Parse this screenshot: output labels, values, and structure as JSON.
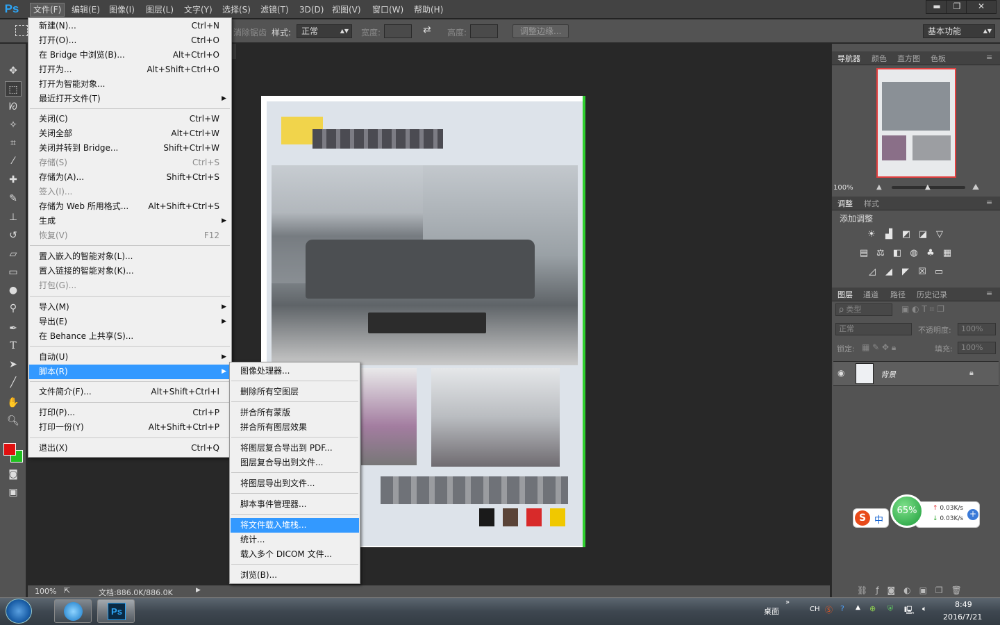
{
  "app": {
    "logo": "Ps"
  },
  "menubar": {
    "items": [
      "文件(F)",
      "编辑(E)",
      "图像(I)",
      "图层(L)",
      "文字(Y)",
      "选择(S)",
      "滤镜(T)",
      "3D(D)",
      "视图(V)",
      "窗口(W)",
      "帮助(H)"
    ],
    "window_buttons": {
      "minimize": "▬",
      "restore": "❐",
      "close": "✕"
    }
  },
  "options_bar": {
    "antialias_label": "消除锯齿",
    "style_label": "样式:",
    "style_value": "正常",
    "width_label": "宽度:",
    "height_label": "高度:",
    "refine_edge": "调整边缘...",
    "workspace": "基本功能"
  },
  "file_menu": {
    "items": [
      {
        "label": "新建(N)...",
        "shortcut": "Ctrl+N"
      },
      {
        "label": "打开(O)...",
        "shortcut": "Ctrl+O"
      },
      {
        "label": "在 Bridge 中浏览(B)...",
        "shortcut": "Alt+Ctrl+O"
      },
      {
        "label": "打开为...",
        "shortcut": "Alt+Shift+Ctrl+O"
      },
      {
        "label": "打开为智能对象...",
        "shortcut": ""
      },
      {
        "label": "最近打开文件(T)",
        "shortcut": ""
      },
      {
        "label": "关闭(C)",
        "shortcut": "Ctrl+W"
      },
      {
        "label": "关闭全部",
        "shortcut": "Alt+Ctrl+W"
      },
      {
        "label": "关闭并转到 Bridge...",
        "shortcut": "Shift+Ctrl+W"
      },
      {
        "label": "存储(S)",
        "shortcut": "Ctrl+S"
      },
      {
        "label": "存储为(A)...",
        "shortcut": "Shift+Ctrl+S"
      },
      {
        "label": "签入(I)...",
        "shortcut": ""
      },
      {
        "label": "存储为 Web 所用格式...",
        "shortcut": "Alt+Shift+Ctrl+S"
      },
      {
        "label": "生成",
        "shortcut": ""
      },
      {
        "label": "恢复(V)",
        "shortcut": "F12"
      },
      {
        "label": "置入嵌入的智能对象(L)...",
        "shortcut": ""
      },
      {
        "label": "置入链接的智能对象(K)...",
        "shortcut": ""
      },
      {
        "label": "打包(G)...",
        "shortcut": ""
      },
      {
        "label": "导入(M)",
        "shortcut": ""
      },
      {
        "label": "导出(E)",
        "shortcut": ""
      },
      {
        "label": "在 Behance 上共享(S)...",
        "shortcut": ""
      },
      {
        "label": "自动(U)",
        "shortcut": ""
      },
      {
        "label": "脚本(R)",
        "shortcut": ""
      },
      {
        "label": "文件简介(F)...",
        "shortcut": "Alt+Shift+Ctrl+I"
      },
      {
        "label": "打印(P)...",
        "shortcut": "Ctrl+P"
      },
      {
        "label": "打印一份(Y)",
        "shortcut": "Alt+Shift+Ctrl+P"
      },
      {
        "label": "退出(X)",
        "shortcut": "Ctrl+Q"
      }
    ]
  },
  "scripts_menu": {
    "items": [
      "图像处理器...",
      "删除所有空图层",
      "拼合所有蒙版",
      "拼合所有图层效果",
      "将图层复合导出到 PDF...",
      "图层复合导出到文件...",
      "将图层导出到文件...",
      "脚本事件管理器...",
      "将文件载入堆栈...",
      "统计...",
      "载入多个 DICOM 文件...",
      "浏览(B)..."
    ]
  },
  "status_bar": {
    "zoom": "100%",
    "doc_info": "文档:886.0K/886.0K"
  },
  "panels": {
    "navigator_tabs": [
      "导航器",
      "颜色",
      "直方图",
      "色板"
    ],
    "navigator_zoom": "100%",
    "adjust_tabs": [
      "调整",
      "样式"
    ],
    "add_adjustment": "添加调整",
    "layers_tabs": [
      "图层",
      "通道",
      "路径",
      "历史记录"
    ],
    "filter_kind": "ρ 类型",
    "blend_mode": "正常",
    "opacity_label": "不透明度:",
    "opacity_value": "100%",
    "lock_label": "锁定:",
    "fill_label": "填充:",
    "fill_value": "100%",
    "layer_name": "背景"
  },
  "speed_widget": {
    "percent": "65%",
    "up": "0.03K/s",
    "down": "0.03K/s",
    "ime": "中"
  },
  "taskbar": {
    "desktop": "桌面",
    "lang": "CH",
    "time": "8:49",
    "date": "2016/7/21",
    "ps_label": "Ps"
  },
  "colors": {
    "accent": "#3399ff",
    "fg_color": "#e01010",
    "bg_color": "#20c020",
    "doc_border": "#2fd02f",
    "swatches": [
      "#1a1a1a",
      "#5a4438",
      "#d82a2a",
      "#f0c800"
    ]
  }
}
